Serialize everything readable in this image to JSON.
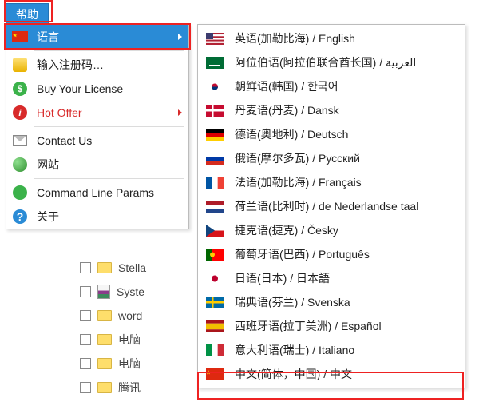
{
  "menubar": {
    "help": "帮助"
  },
  "menu": {
    "language": "语言",
    "enter_code": "输入注册码…",
    "buy": "Buy Your License",
    "hot_offer": "Hot Offer",
    "contact": "Contact Us",
    "website": "网站",
    "cmdline": "Command Line Params",
    "about": "关于"
  },
  "languages": [
    {
      "flag": "us",
      "label": "英语(加勒比海) / English"
    },
    {
      "flag": "sa",
      "label": "阿位伯语(阿拉伯联合酋长国) / العربية"
    },
    {
      "flag": "kr",
      "label": "朝鲜语(韩国) / 한국어"
    },
    {
      "flag": "dk",
      "label": "丹麦语(丹麦) / Dansk"
    },
    {
      "flag": "de",
      "label": "德语(奥地利) / Deutsch"
    },
    {
      "flag": "ru",
      "label": "俄语(摩尔多瓦) / Русский"
    },
    {
      "flag": "fr",
      "label": "法语(加勒比海) / Français"
    },
    {
      "flag": "nl",
      "label": "荷兰语(比利时) / de Nederlandse taal"
    },
    {
      "flag": "cz",
      "label": "捷克语(捷克) / Česky"
    },
    {
      "flag": "pt",
      "label": "葡萄牙语(巴西) / Português"
    },
    {
      "flag": "jp",
      "label": "日语(日本) / 日本語"
    },
    {
      "flag": "se",
      "label": "瑞典语(芬兰) / Svenska"
    },
    {
      "flag": "es",
      "label": "西班牙语(拉丁美洲) / Español"
    },
    {
      "flag": "it",
      "label": "意大利语(瑞士) / Italiano"
    },
    {
      "flag": "cn",
      "label": "中文(简体，中国) / 中文"
    }
  ],
  "tree": [
    {
      "type": "folder",
      "label": "Stella"
    },
    {
      "type": "rar",
      "label": "Syste"
    },
    {
      "type": "folder",
      "label": "word"
    },
    {
      "type": "folder",
      "label": "电脑"
    },
    {
      "type": "folder",
      "label": "电脑"
    },
    {
      "type": "folder",
      "label": "腾讯"
    }
  ]
}
